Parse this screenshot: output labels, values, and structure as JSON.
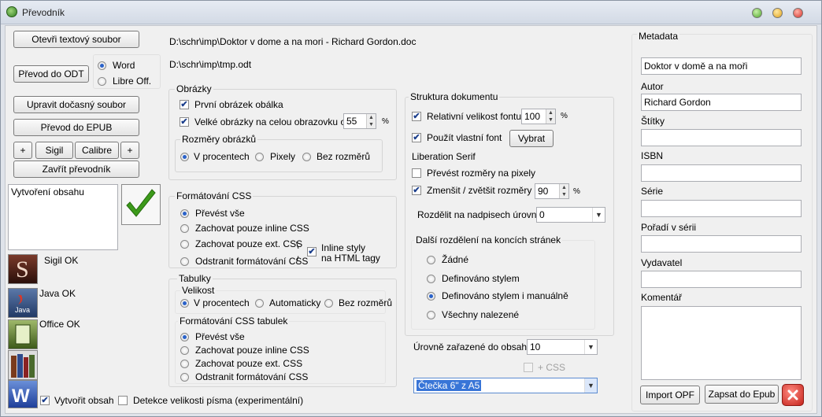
{
  "window": {
    "title": "Převodník"
  },
  "left": {
    "open_button": "Otevři textový soubor",
    "convert_odt_button": "Převod do ODT",
    "radio_word": "Word",
    "radio_libre": "Libre Off.",
    "edit_temp_button": "Upravit dočasný soubor",
    "convert_epub_button": "Převod do EPUB",
    "plus_left": "+",
    "sigil_button": "Sigil",
    "calibre_button": "Calibre",
    "plus_right": "+",
    "close_button": "Zavřít převodník",
    "log_text": "Vytvoření obsahu",
    "status_sigil": "Sigil OK",
    "status_java": "Java OK",
    "status_office": "Office OK",
    "create_toc_label": "Vytvořit obsah",
    "font_size_detect_label": "Detekce velikosti písma (experimentální)"
  },
  "paths": {
    "source": "D:\\schr\\imp\\Doktor v dome a na mori - Richard Gordon.doc",
    "target": "D:\\schr\\imp\\tmp.odt"
  },
  "images": {
    "title": "Obrázky",
    "first_cover": "První obrázek obálka",
    "big_fullscreen": "Velké obrázky na celou obrazovku od",
    "big_value": "55",
    "pct": "%",
    "dims_title": "Rozměry obrázků",
    "opt_percent": "V procentech",
    "opt_pixels": "Pixely",
    "opt_none": "Bez rozměrů"
  },
  "css": {
    "title": "Formátování CSS",
    "opt_all": "Převést vše",
    "opt_inline": "Zachovat pouze inline CSS",
    "opt_ext": "Zachovat pouze ext. CSS",
    "opt_remove": "Odstranit formátování CSS",
    "inline_html_1": "Inline styly",
    "inline_html_2": "na HTML tagy",
    "sep_top": "\\",
    "sep_bottom": "/"
  },
  "tables": {
    "title": "Tabulky",
    "size_title": "Velikost",
    "opt_percent": "V procentech",
    "opt_auto": "Automaticky",
    "opt_none": "Bez rozměrů",
    "css_title": "Formátování CSS tabulek",
    "css_all": "Převést vše",
    "css_inline": "Zachovat pouze inline CSS",
    "css_ext": "Zachovat pouze ext. CSS",
    "css_remove": "Odstranit formátování CSS"
  },
  "structure": {
    "title": "Struktura dokumentu",
    "relative_font": "Relativní velikost fontu",
    "relative_value": "100",
    "pct": "%",
    "own_font": "Použít vlastní font",
    "choose_button": "Vybrat",
    "font_name": "Liberation Serif",
    "px_convert": "Převést rozměry na pixely",
    "shrink": "Zmenšit / zvětšit rozměry na",
    "shrink_value": "90",
    "pct2": "%",
    "split_label": "Rozdělit na nadpisech úrovně",
    "split_value": "0",
    "page_split_title": "Další rozdělení na koncích stránek",
    "ps_none": "Žádné",
    "ps_style": "Definováno stylem",
    "ps_style_manual": "Definováno stylem i manuálně",
    "ps_all": "Všechny nalezené",
    "toc_levels_label": "Úrovně zařazené do obsahu",
    "toc_levels_value": "10",
    "css_extra": "+ CSS",
    "reader_value": "Čtečka 6\" z A5"
  },
  "metadata": {
    "title": "Metadata",
    "book_title": "Doktor v domě a na moři",
    "author_label": "Autor",
    "author": "Richard Gordon",
    "tags_label": "Štítky",
    "isbn_label": "ISBN",
    "series_label": "Série",
    "order_label": "Pořadí v sérii",
    "publisher_label": "Vydavatel",
    "comment_label": "Komentář",
    "import_button": "Import OPF",
    "write_button": "Zapsat do Epub"
  },
  "colors": {
    "accent": "#2a62c9",
    "check_green": "#3c9a1a",
    "close_red": "#d6312a"
  }
}
